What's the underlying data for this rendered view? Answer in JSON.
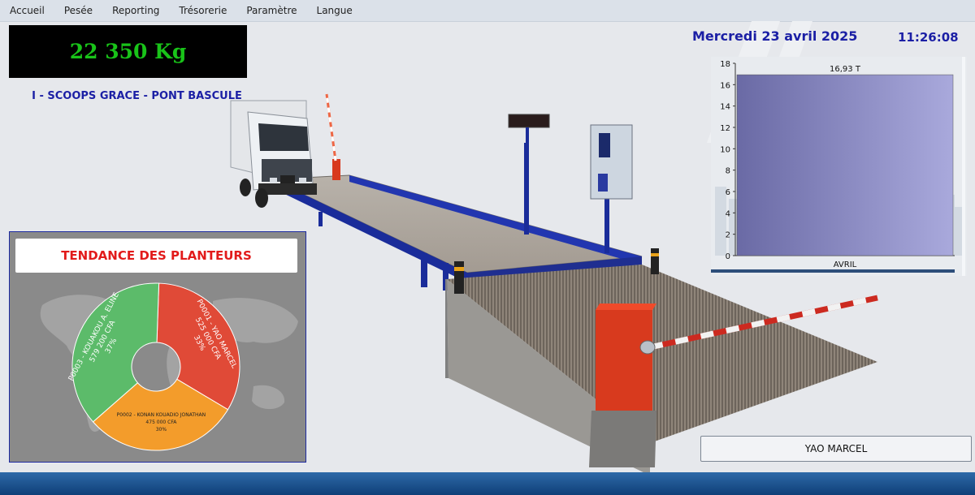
{
  "menu": {
    "items": [
      "Accueil",
      "Pesée",
      "Reporting",
      "Trésorerie",
      "Paramètre",
      "Langue"
    ]
  },
  "weight": {
    "display": "22 350 Kg"
  },
  "site": {
    "name": "I - SCOOPS GRACE - PONT BASCULE"
  },
  "datetime": {
    "date": "Mercredi 23 avril 2025",
    "time": "11:26:08"
  },
  "operator": {
    "name": "YAO MARCEL"
  },
  "colors": {
    "weight_text": "#19c319",
    "header_text": "#1b1fa5",
    "title_red": "#e21b1b",
    "pie_red": "#e04a37",
    "pie_green": "#5cbb6a",
    "pie_orange": "#f39c2b"
  },
  "chart_data": {
    "type": "bar",
    "categories": [
      "AVRIL"
    ],
    "values": [
      16.93
    ],
    "data_labels": [
      "16,93 T"
    ],
    "ylim": [
      0,
      18
    ],
    "yticks": [
      0,
      2,
      4,
      6,
      8,
      10,
      12,
      14,
      16,
      18
    ],
    "grid": false,
    "title": "",
    "xlabel": "",
    "ylabel": ""
  },
  "planters": {
    "title": "TENDANCE DES PLANTEURS",
    "chart_data": {
      "type": "pie",
      "slices": [
        {
          "code": "P0001 - YAO MARCEL",
          "amount": "525 000 CFA",
          "percent_label": "33%",
          "value": 33,
          "color": "#e04a37"
        },
        {
          "code": "P0002 - KONAN KOUADIO JONATHAN",
          "amount": "475 000 CFA",
          "percent_label": "30%",
          "value": 30,
          "color": "#f39c2b"
        },
        {
          "code": "P0003 - KOUAKOU A. ELINE",
          "amount": "579 200 CFA",
          "percent_label": "37%",
          "value": 37,
          "color": "#5cbb6a"
        }
      ]
    }
  }
}
